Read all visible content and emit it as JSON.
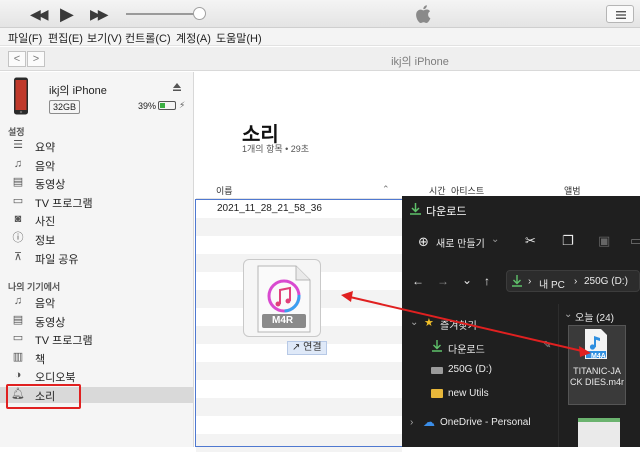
{
  "player": {
    "prev": "◀◀",
    "play": "▶",
    "next": "▶▶"
  },
  "menu": [
    "파일(F)",
    "편집(E)",
    "보기(V)",
    "컨트롤(C)",
    "계정(A)",
    "도움말(H)"
  ],
  "nav": {
    "back": "<",
    "forward": ">",
    "title": "ikj의 iPhone"
  },
  "device": {
    "name": "ikj의 iPhone",
    "capacity": "32GB",
    "battery_text": "39%",
    "battery_level": 0.39
  },
  "sidebar": {
    "settings_header": "설정",
    "settings_items": [
      {
        "icon": "summary-icon",
        "glyph": "☰",
        "label": "요약"
      },
      {
        "icon": "music-icon",
        "glyph": "♫",
        "label": "음악"
      },
      {
        "icon": "film-icon",
        "glyph": "▤",
        "label": "동영상"
      },
      {
        "icon": "tv-icon",
        "glyph": "▭",
        "label": "TV 프로그램"
      },
      {
        "icon": "camera-icon",
        "glyph": "◙",
        "label": "사진"
      },
      {
        "icon": "info-icon",
        "glyph": "ⓘ",
        "label": "정보"
      },
      {
        "icon": "share-icon",
        "glyph": "⊼",
        "label": "파일 공유"
      }
    ],
    "device_header": "나의 기기에서",
    "device_items": [
      {
        "icon": "music-icon",
        "glyph": "♫",
        "label": "음악"
      },
      {
        "icon": "film-icon",
        "glyph": "▤",
        "label": "동영상"
      },
      {
        "icon": "tv-icon",
        "glyph": "▭",
        "label": "TV 프로그램"
      },
      {
        "icon": "book-icon",
        "glyph": "▥",
        "label": "책"
      },
      {
        "icon": "audiobook-icon",
        "glyph": "◑",
        "label": "오디오북"
      },
      {
        "icon": "bell-icon",
        "glyph": "🔔︎",
        "label": "소리"
      }
    ]
  },
  "main": {
    "title": "소리",
    "subtitle": "1개의 항목 • 29초",
    "columns": [
      "이름",
      "시간",
      "아티스트",
      "앨범"
    ],
    "rows": [
      "2021_11_28_21_58_36"
    ]
  },
  "drag": {
    "file_type": "M4R",
    "action_label": "↗ 연결"
  },
  "explorer": {
    "title": "다운로드",
    "new_button": "새로 만들기",
    "path": [
      "내 PC",
      "250G (D:)"
    ],
    "nav_items": [
      {
        "icon": "star-icon",
        "label": "즐겨찾기"
      },
      {
        "icon": "download-icon",
        "label": "다운로드"
      },
      {
        "icon": "drive-icon",
        "label": "250G (D:)"
      },
      {
        "icon": "folder-icon",
        "label": "new Utils"
      },
      {
        "icon": "cloud-icon",
        "label": "OneDrive - Personal"
      }
    ],
    "group_header": "오늘 (24)",
    "file": {
      "type": "M4A",
      "name": "TITANIC-JACK DIES.m4r"
    }
  },
  "colors": {
    "annotation_red": "#e02020",
    "selection_blue": "#4f78d0",
    "explorer_bg": "#1f1f1f"
  }
}
